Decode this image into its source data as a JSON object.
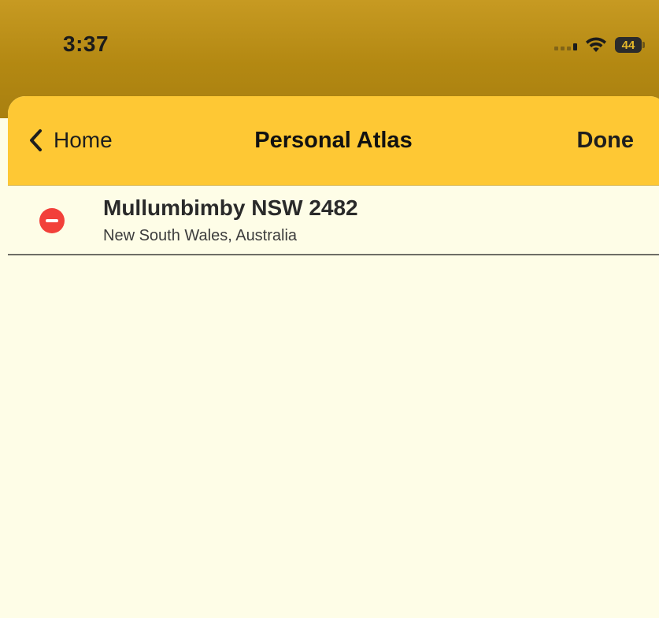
{
  "status_bar": {
    "time": "3:37",
    "battery": "44",
    "icons": [
      "cellular-signal-icon",
      "wifi-icon",
      "battery-icon"
    ]
  },
  "navbar": {
    "back_label": "Home",
    "title": "Personal Atlas",
    "done_label": "Done",
    "background_color": "#fec834"
  },
  "list": {
    "items": [
      {
        "title": "Mullumbimby NSW 2482",
        "subtitle": "New South Wales, Australia",
        "action_icon": "delete-minus-icon",
        "action_color": "#f2403a"
      }
    ]
  },
  "colors": {
    "sheet_background": "#fefde7",
    "status_backdrop": "#b38812"
  }
}
